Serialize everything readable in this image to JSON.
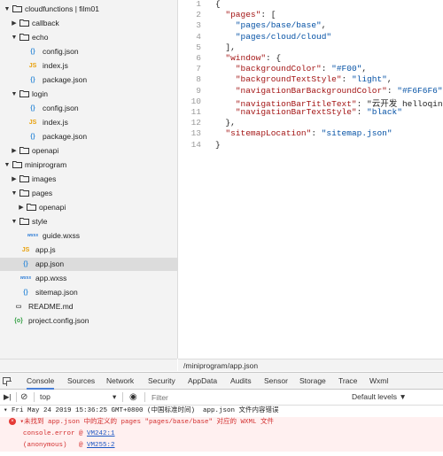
{
  "tree": {
    "items": [
      {
        "label": "cloudfunctions | film01",
        "type": "folder",
        "arrow": "▼",
        "indent": 0
      },
      {
        "label": "callback",
        "type": "folder",
        "arrow": "▶",
        "indent": 1
      },
      {
        "label": "echo",
        "type": "folder",
        "arrow": "▼",
        "indent": 1
      },
      {
        "label": "config.json",
        "type": "json",
        "indent": 3
      },
      {
        "label": "index.js",
        "type": "js",
        "indent": 3
      },
      {
        "label": "package.json",
        "type": "json",
        "indent": 3
      },
      {
        "label": "login",
        "type": "folder",
        "arrow": "▼",
        "indent": 1
      },
      {
        "label": "config.json",
        "type": "json",
        "indent": 3
      },
      {
        "label": "index.js",
        "type": "js",
        "indent": 3
      },
      {
        "label": "package.json",
        "type": "json",
        "indent": 3
      },
      {
        "label": "openapi",
        "type": "folder",
        "arrow": "▶",
        "indent": 1
      },
      {
        "label": "miniprogram",
        "type": "folder",
        "arrow": "▼",
        "indent": 0
      },
      {
        "label": "images",
        "type": "folder",
        "arrow": "▶",
        "indent": 1
      },
      {
        "label": "pages",
        "type": "folder",
        "arrow": "▼",
        "indent": 1
      },
      {
        "label": "openapi",
        "type": "folder",
        "arrow": "▶",
        "indent": 2
      },
      {
        "label": "style",
        "type": "folder",
        "arrow": "▼",
        "indent": 1
      },
      {
        "label": "guide.wxss",
        "type": "wxss",
        "indent": 3
      },
      {
        "label": "app.js",
        "type": "js",
        "indent": 2
      },
      {
        "label": "app.json",
        "type": "json",
        "indent": 2,
        "selected": true
      },
      {
        "label": "app.wxss",
        "type": "wxss",
        "indent": 2
      },
      {
        "label": "sitemap.json",
        "type": "json",
        "indent": 2
      },
      {
        "label": "README.md",
        "type": "md",
        "indent": 1
      },
      {
        "label": "project.config.json",
        "type": "proj",
        "indent": 1
      }
    ]
  },
  "icons": {
    "json": "{}",
    "js": "JS",
    "wxss": "wxss",
    "md": "▭",
    "proj": "{o}"
  },
  "editor": {
    "line_numbers": [
      "1",
      "2",
      "3",
      "4",
      "5",
      "6",
      "7",
      "8",
      "9",
      "10",
      "11",
      "12",
      "13",
      "14"
    ],
    "lines": [
      "{",
      "  \"pages\": [",
      "    \"pages/base/base\",",
      "    \"pages/cloud/cloud\"",
      "  ],",
      "  \"window\": {",
      "    \"backgroundColor\": \"#F00\",",
      "    \"backgroundTextStyle\": \"light\",",
      "    \"navigationBarBackgroundColor\": \"#F6F6F6\",",
      "    \"navigationBarTitleText\": \"云开发 helloqin",
      "    \"navigationBarTextStyle\": \"black\"",
      "  },",
      "  \"sitemapLocation\": \"sitemap.json\"",
      "}"
    ]
  },
  "path_bar": "/miniprogram/app.json",
  "devtools": {
    "tabs": [
      "Console",
      "Sources",
      "Network",
      "Security",
      "AppData",
      "Audits",
      "Sensor",
      "Storage",
      "Trace",
      "Wxml"
    ],
    "active_tab": "Console",
    "context": "top",
    "filter_placeholder": "Filter",
    "levels": "Default levels ▼"
  },
  "console": {
    "line1": "▾ Fri May 24 2019 15:36:25 GMT+0800 (中国标准时间)  app.json 文件内容错误",
    "line2_prefix": "▾未找到 app.json 中的定义的 pages \"pages/base/base\" 对应的 WXML 文件",
    "line3_text": "console.error @ ",
    "line3_link": "VM242:1",
    "line4_text": "(anonymous)   @ ",
    "line4_link": "VM255:2"
  },
  "colors": {
    "accent": "#4a80d8",
    "error": "#d32f2f",
    "key": "#a31515",
    "string": "#0451a5"
  }
}
